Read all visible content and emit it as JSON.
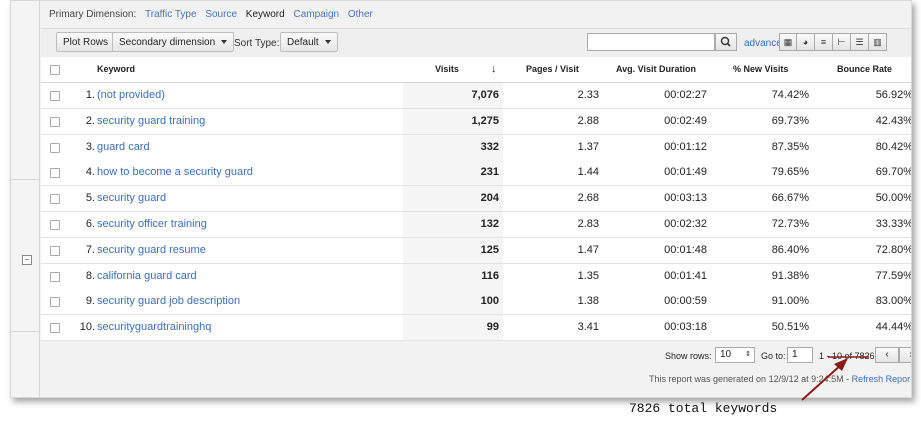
{
  "primary_dimension": {
    "label": "Primary Dimension:",
    "options": [
      "Traffic Type",
      "Source",
      "Keyword",
      "Campaign",
      "Other"
    ],
    "selected": "Keyword"
  },
  "toolbar": {
    "plot_rows": "Plot Rows",
    "secondary_dimension": "Secondary dimension",
    "sort_type_label": "Sort Type:",
    "sort_type_value": "Default",
    "search_value": "",
    "advanced": "advanced"
  },
  "table": {
    "headers": {
      "keyword": "Keyword",
      "visits": "Visits",
      "pages_visit": "Pages / Visit",
      "avg_duration": "Avg. Visit Duration",
      "new_visits": "% New Visits",
      "bounce_rate": "Bounce Rate"
    },
    "rows": [
      {
        "idx": "1.",
        "keyword": "(not provided)",
        "visits": "7,076",
        "pages": "2.33",
        "duration": "00:02:27",
        "new": "74.42%",
        "bounce": "56.92%"
      },
      {
        "idx": "2.",
        "keyword": "security guard training",
        "visits": "1,275",
        "pages": "2.88",
        "duration": "00:02:49",
        "new": "69.73%",
        "bounce": "42.43%"
      },
      {
        "idx": "3.",
        "keyword": "guard card",
        "visits": "332",
        "pages": "1.37",
        "duration": "00:01:12",
        "new": "87.35%",
        "bounce": "80.42%"
      },
      {
        "idx": "4.",
        "keyword": "how to become a security guard",
        "visits": "231",
        "pages": "1.44",
        "duration": "00:01:49",
        "new": "79.65%",
        "bounce": "69.70%"
      },
      {
        "idx": "5.",
        "keyword": "security guard",
        "visits": "204",
        "pages": "2.68",
        "duration": "00:03:13",
        "new": "66.67%",
        "bounce": "50.00%"
      },
      {
        "idx": "6.",
        "keyword": "security officer training",
        "visits": "132",
        "pages": "2.83",
        "duration": "00:02:32",
        "new": "72.73%",
        "bounce": "33.33%"
      },
      {
        "idx": "7.",
        "keyword": "security guard resume",
        "visits": "125",
        "pages": "1.47",
        "duration": "00:01:48",
        "new": "86.40%",
        "bounce": "72.80%"
      },
      {
        "idx": "8.",
        "keyword": "california guard card",
        "visits": "116",
        "pages": "1.35",
        "duration": "00:01:41",
        "new": "91.38%",
        "bounce": "77.59%"
      },
      {
        "idx": "9.",
        "keyword": "security guard job description",
        "visits": "100",
        "pages": "1.38",
        "duration": "00:00:59",
        "new": "91.00%",
        "bounce": "83.00%"
      },
      {
        "idx": "10.",
        "keyword": "securityguardtraininghq",
        "visits": "99",
        "pages": "3.41",
        "duration": "00:03:18",
        "new": "50.51%",
        "bounce": "44.44%"
      }
    ]
  },
  "footer": {
    "show_rows_label": "Show rows:",
    "show_rows_value": "10",
    "goto_label": "Go to:",
    "goto_value": "1",
    "range": "1 - 10 of 7826",
    "generated": "This report was generated on 12/9/12 at 9:24:5",
    "generated_tail": "M - ",
    "refresh": "Refresh Repor"
  },
  "annotation": {
    "text": "7826 total keywords",
    "color": "#8b1a1a"
  }
}
